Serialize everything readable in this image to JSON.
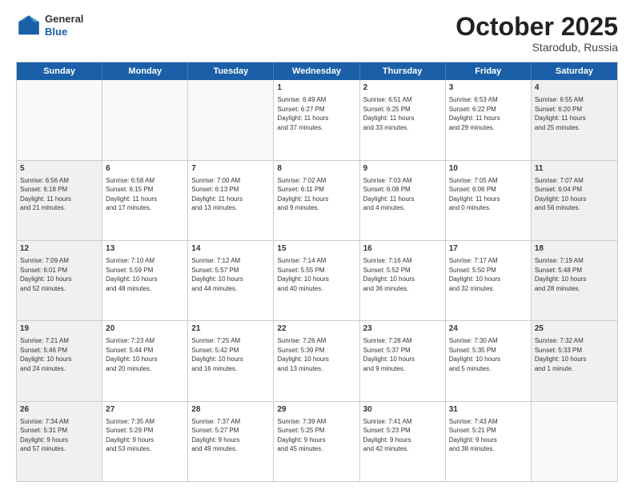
{
  "header": {
    "logo_general": "General",
    "logo_blue": "Blue",
    "month": "October 2025",
    "location": "Starodub, Russia"
  },
  "weekdays": [
    "Sunday",
    "Monday",
    "Tuesday",
    "Wednesday",
    "Thursday",
    "Friday",
    "Saturday"
  ],
  "rows": [
    [
      {
        "day": "",
        "text": "",
        "empty": true
      },
      {
        "day": "",
        "text": "",
        "empty": true
      },
      {
        "day": "",
        "text": "",
        "empty": true
      },
      {
        "day": "1",
        "text": "Sunrise: 6:49 AM\nSunset: 6:27 PM\nDaylight: 11 hours\nand 37 minutes."
      },
      {
        "day": "2",
        "text": "Sunrise: 6:51 AM\nSunset: 6:25 PM\nDaylight: 11 hours\nand 33 minutes."
      },
      {
        "day": "3",
        "text": "Sunrise: 6:53 AM\nSunset: 6:22 PM\nDaylight: 11 hours\nand 29 minutes."
      },
      {
        "day": "4",
        "text": "Sunrise: 6:55 AM\nSunset: 6:20 PM\nDaylight: 11 hours\nand 25 minutes."
      }
    ],
    [
      {
        "day": "5",
        "text": "Sunrise: 6:56 AM\nSunset: 6:18 PM\nDaylight: 11 hours\nand 21 minutes."
      },
      {
        "day": "6",
        "text": "Sunrise: 6:58 AM\nSunset: 6:15 PM\nDaylight: 11 hours\nand 17 minutes."
      },
      {
        "day": "7",
        "text": "Sunrise: 7:00 AM\nSunset: 6:13 PM\nDaylight: 11 hours\nand 13 minutes."
      },
      {
        "day": "8",
        "text": "Sunrise: 7:02 AM\nSunset: 6:11 PM\nDaylight: 11 hours\nand 9 minutes."
      },
      {
        "day": "9",
        "text": "Sunrise: 7:03 AM\nSunset: 6:08 PM\nDaylight: 11 hours\nand 4 minutes."
      },
      {
        "day": "10",
        "text": "Sunrise: 7:05 AM\nSunset: 6:06 PM\nDaylight: 11 hours\nand 0 minutes."
      },
      {
        "day": "11",
        "text": "Sunrise: 7:07 AM\nSunset: 6:04 PM\nDaylight: 10 hours\nand 56 minutes."
      }
    ],
    [
      {
        "day": "12",
        "text": "Sunrise: 7:09 AM\nSunset: 6:01 PM\nDaylight: 10 hours\nand 52 minutes."
      },
      {
        "day": "13",
        "text": "Sunrise: 7:10 AM\nSunset: 5:59 PM\nDaylight: 10 hours\nand 48 minutes."
      },
      {
        "day": "14",
        "text": "Sunrise: 7:12 AM\nSunset: 5:57 PM\nDaylight: 10 hours\nand 44 minutes."
      },
      {
        "day": "15",
        "text": "Sunrise: 7:14 AM\nSunset: 5:55 PM\nDaylight: 10 hours\nand 40 minutes."
      },
      {
        "day": "16",
        "text": "Sunrise: 7:16 AM\nSunset: 5:52 PM\nDaylight: 10 hours\nand 36 minutes."
      },
      {
        "day": "17",
        "text": "Sunrise: 7:17 AM\nSunset: 5:50 PM\nDaylight: 10 hours\nand 32 minutes."
      },
      {
        "day": "18",
        "text": "Sunrise: 7:19 AM\nSunset: 5:48 PM\nDaylight: 10 hours\nand 28 minutes."
      }
    ],
    [
      {
        "day": "19",
        "text": "Sunrise: 7:21 AM\nSunset: 5:46 PM\nDaylight: 10 hours\nand 24 minutes."
      },
      {
        "day": "20",
        "text": "Sunrise: 7:23 AM\nSunset: 5:44 PM\nDaylight: 10 hours\nand 20 minutes."
      },
      {
        "day": "21",
        "text": "Sunrise: 7:25 AM\nSunset: 5:42 PM\nDaylight: 10 hours\nand 16 minutes."
      },
      {
        "day": "22",
        "text": "Sunrise: 7:26 AM\nSunset: 5:39 PM\nDaylight: 10 hours\nand 13 minutes."
      },
      {
        "day": "23",
        "text": "Sunrise: 7:28 AM\nSunset: 5:37 PM\nDaylight: 10 hours\nand 9 minutes."
      },
      {
        "day": "24",
        "text": "Sunrise: 7:30 AM\nSunset: 5:35 PM\nDaylight: 10 hours\nand 5 minutes."
      },
      {
        "day": "25",
        "text": "Sunrise: 7:32 AM\nSunset: 5:33 PM\nDaylight: 10 hours\nand 1 minute."
      }
    ],
    [
      {
        "day": "26",
        "text": "Sunrise: 7:34 AM\nSunset: 5:31 PM\nDaylight: 9 hours\nand 57 minutes."
      },
      {
        "day": "27",
        "text": "Sunrise: 7:35 AM\nSunset: 5:29 PM\nDaylight: 9 hours\nand 53 minutes."
      },
      {
        "day": "28",
        "text": "Sunrise: 7:37 AM\nSunset: 5:27 PM\nDaylight: 9 hours\nand 49 minutes."
      },
      {
        "day": "29",
        "text": "Sunrise: 7:39 AM\nSunset: 5:25 PM\nDaylight: 9 hours\nand 45 minutes."
      },
      {
        "day": "30",
        "text": "Sunrise: 7:41 AM\nSunset: 5:23 PM\nDaylight: 9 hours\nand 42 minutes."
      },
      {
        "day": "31",
        "text": "Sunrise: 7:43 AM\nSunset: 5:21 PM\nDaylight: 9 hours\nand 38 minutes."
      },
      {
        "day": "",
        "text": "",
        "empty": true
      }
    ]
  ]
}
